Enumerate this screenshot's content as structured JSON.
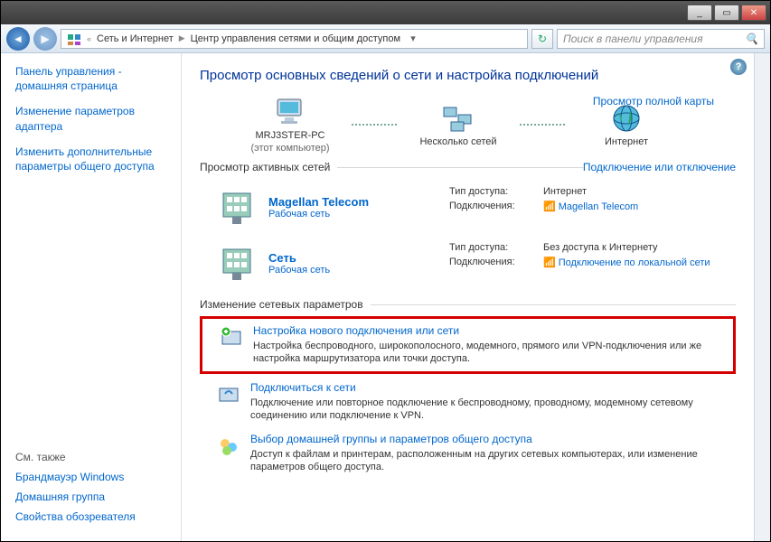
{
  "titlebar": {
    "min": "_",
    "max": "▭",
    "close": "✕"
  },
  "nav": {
    "back": "◄",
    "fwd": "▶",
    "crumb1": "Сеть и Интернет",
    "crumb2": "Центр управления сетями и общим доступом",
    "search_placeholder": "Поиск в панели управления",
    "refresh": "↻"
  },
  "sidebar": {
    "links": [
      "Панель управления - домашняя страница",
      "Изменение параметров адаптера",
      "Изменить дополнительные параметры общего доступа"
    ],
    "see_also": "См. также",
    "bottom": [
      "Брандмауэр Windows",
      "Домашняя группа",
      "Свойства обозревателя"
    ]
  },
  "main": {
    "heading": "Просмотр основных сведений о сети и настройка подключений",
    "map": {
      "node1": "MRJ3STER-PC",
      "node1sub": "(этот компьютер)",
      "node2": "Несколько сетей",
      "node3": "Интернет",
      "full_map": "Просмотр полной карты"
    },
    "active_header": "Просмотр активных сетей",
    "active_link": "Подключение или отключение",
    "net1": {
      "name": "Magellan Telecom",
      "type": "Рабочая сеть",
      "k1": "Тип доступа:",
      "v1": "Интернет",
      "k2": "Подключения:",
      "v2": "Magellan Telecom"
    },
    "net2": {
      "name": "Сеть",
      "type": "Рабочая сеть",
      "k1": "Тип доступа:",
      "v1": "Без доступа к Интернету",
      "k2": "Подключения:",
      "v2": "Подключение по локальной сети"
    },
    "change_header": "Изменение сетевых параметров",
    "task1": {
      "title": "Настройка нового подключения или сети",
      "text": "Настройка беспроводного, широкополосного, модемного, прямого или VPN-подключения или же настройка маршрутизатора или точки доступа."
    },
    "task2": {
      "title": "Подключиться к сети",
      "text": "Подключение или повторное подключение к беспроводному, проводному, модемному сетевому соединению или подключение к VPN."
    },
    "task3": {
      "title": "Выбор домашней группы и параметров общего доступа",
      "text": "Доступ к файлам и принтерам, расположенным на других сетевых компьютерах, или изменение параметров общего доступа."
    }
  }
}
